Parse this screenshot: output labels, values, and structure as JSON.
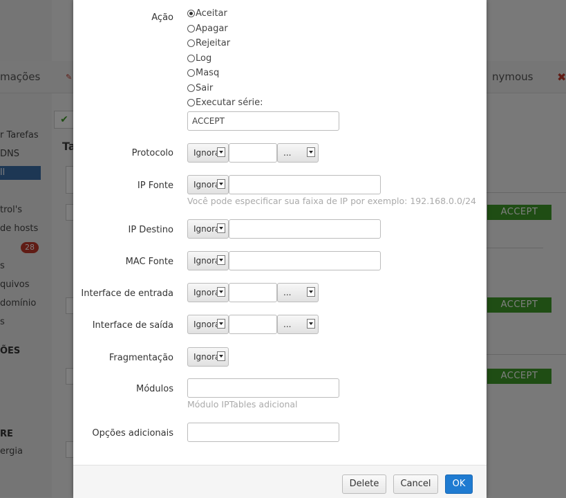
{
  "background": {
    "nav": {
      "left_text": "mações",
      "right_text": "nymous"
    },
    "sidebar": {
      "items": [
        "r Tarefas",
        "DNS",
        "ll",
        "trol's",
        "de hosts",
        "s",
        "quivos",
        "domínio",
        "s"
      ],
      "badge": "28",
      "sections": [
        "ÕES",
        "RE",
        "ergia"
      ]
    },
    "content_heading": "Ta",
    "accept_label": "ACCEPT",
    "check_mark": "✔",
    "close_mark": "✖"
  },
  "modal": {
    "acao": {
      "label": "Ação",
      "options": [
        {
          "label": "Aceitar",
          "checked": true
        },
        {
          "label": "Apagar",
          "checked": false
        },
        {
          "label": "Rejeitar",
          "checked": false
        },
        {
          "label": "Log",
          "checked": false
        },
        {
          "label": "Masq",
          "checked": false
        },
        {
          "label": "Sair",
          "checked": false
        },
        {
          "label": "Executar série:",
          "checked": false
        }
      ],
      "chain_value": "ACCEPT"
    },
    "protocolo": {
      "label": "Protocolo",
      "select": "Ignorar",
      "value": "",
      "dropdown": "..."
    },
    "ip_fonte": {
      "label": "IP Fonte",
      "select": "Ignorar",
      "value": "",
      "hint": "Você pode especificar sua faixa de IP por exemplo: 192.168.0.0/24"
    },
    "ip_destino": {
      "label": "IP Destino",
      "select": "Ignorar",
      "value": ""
    },
    "mac_fonte": {
      "label": "MAC Fonte",
      "select": "Ignorar",
      "value": ""
    },
    "interface_entrada": {
      "label": "Interface de entrada",
      "select": "Ignorar",
      "value": "",
      "dropdown": "..."
    },
    "interface_saida": {
      "label": "Interface de saída",
      "select": "Ignorar",
      "value": "",
      "dropdown": "..."
    },
    "fragmentacao": {
      "label": "Fragmentação",
      "select": "Ignorar"
    },
    "modulos": {
      "label": "Módulos",
      "value": "",
      "hint": "Módulo IPTables adicional"
    },
    "opcoes": {
      "label": "Opções adicionais",
      "value": ""
    },
    "buttons": {
      "delete": "Delete",
      "cancel": "Cancel",
      "ok": "OK"
    }
  }
}
